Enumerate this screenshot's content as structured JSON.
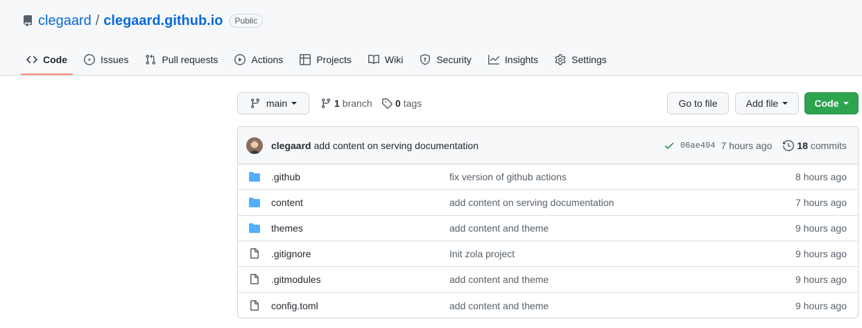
{
  "repo": {
    "owner": "clegaard",
    "separator": "/",
    "name": "clegaard.github.io",
    "visibility": "Public",
    "icon": "repo-icon"
  },
  "nav": [
    {
      "label": "Code",
      "icon": "code-icon",
      "active": true
    },
    {
      "label": "Issues",
      "icon": "issue-opened-icon"
    },
    {
      "label": "Pull requests",
      "icon": "git-pull-request-icon"
    },
    {
      "label": "Actions",
      "icon": "play-icon"
    },
    {
      "label": "Projects",
      "icon": "table-icon"
    },
    {
      "label": "Wiki",
      "icon": "book-icon"
    },
    {
      "label": "Security",
      "icon": "shield-icon"
    },
    {
      "label": "Insights",
      "icon": "graph-icon"
    },
    {
      "label": "Settings",
      "icon": "gear-icon"
    }
  ],
  "toolbar": {
    "branch": "main",
    "branch_count": "1",
    "branch_label": "branch",
    "tag_count": "0",
    "tag_label": "tags",
    "goto_file": "Go to file",
    "add_file": "Add file",
    "code": "Code"
  },
  "latest_commit": {
    "author": "clegaard",
    "message": "add content on serving documentation",
    "sha": "06ae494",
    "time": "7 hours ago",
    "commit_count": "18",
    "commit_label": "commits",
    "status": "success"
  },
  "files": [
    {
      "type": "dir",
      "name": ".github",
      "message": "fix version of github actions",
      "time": "8 hours ago"
    },
    {
      "type": "dir",
      "name": "content",
      "message": "add content on serving documentation",
      "time": "7 hours ago"
    },
    {
      "type": "dir",
      "name": "themes",
      "message": "add content and theme",
      "time": "9 hours ago"
    },
    {
      "type": "file",
      "name": ".gitignore",
      "message": "Init zola project",
      "time": "9 hours ago"
    },
    {
      "type": "file",
      "name": ".gitmodules",
      "message": "add content and theme",
      "time": "9 hours ago"
    },
    {
      "type": "file",
      "name": "config.toml",
      "message": "add content and theme",
      "time": "9 hours ago"
    }
  ],
  "colors": {
    "link": "#0969da",
    "primary_button": "#2da44e",
    "active_tab_underline": "#fd8c73",
    "folder": "#54aeff",
    "success": "#1a7f37"
  }
}
